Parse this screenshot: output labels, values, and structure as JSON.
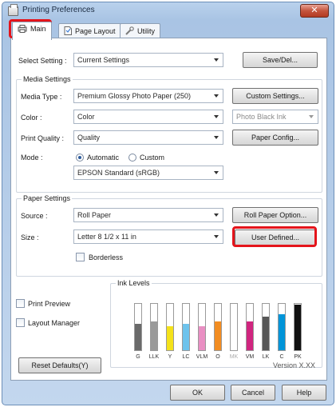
{
  "window": {
    "title": "Printing Preferences",
    "close_label": "✕"
  },
  "tabs": [
    {
      "label": "Main",
      "icon": "printer-icon",
      "active": true
    },
    {
      "label": "Page Layout",
      "icon": "page-layout-icon",
      "active": false
    },
    {
      "label": "Utility",
      "icon": "utility-icon",
      "active": false
    }
  ],
  "select_setting": {
    "label": "Select Setting :",
    "value": "Current Settings",
    "save_del_label": "Save/Del..."
  },
  "media_settings": {
    "group_label": "Media Settings",
    "media_type_label": "Media Type :",
    "media_type_value": "Premium Glossy Photo Paper (250)",
    "custom_settings_label": "Custom Settings...",
    "color_label": "Color :",
    "color_value": "Color",
    "black_ink_value": "Photo Black Ink",
    "print_quality_label": "Print Quality :",
    "print_quality_value": "Quality",
    "paper_config_label": "Paper Config...",
    "mode_label": "Mode :",
    "mode_automatic_label": "Automatic",
    "mode_custom_label": "Custom",
    "mode_selected": "Automatic",
    "color_mode_value": "EPSON Standard (sRGB)"
  },
  "paper_settings": {
    "group_label": "Paper Settings",
    "source_label": "Source :",
    "source_value": "Roll Paper",
    "roll_paper_option_label": "Roll Paper Option...",
    "size_label": "Size :",
    "size_value": "Letter 8 1/2 x 11 in",
    "user_defined_label": "User Defined...",
    "borderless_label": "Borderless"
  },
  "options": {
    "print_preview_label": "Print Preview",
    "layout_manager_label": "Layout Manager"
  },
  "ink_levels": {
    "group_label": "Ink Levels",
    "inks": [
      {
        "label": "G",
        "level": 0.55,
        "color": "#6a6a6a"
      },
      {
        "label": "LLK",
        "level": 0.6,
        "color": "#9a9a9a"
      },
      {
        "label": "Y",
        "level": 0.5,
        "color": "#f4e21a"
      },
      {
        "label": "LC",
        "level": 0.55,
        "color": "#6ec3ec"
      },
      {
        "label": "VLM",
        "level": 0.5,
        "color": "#e98fc3"
      },
      {
        "label": "O",
        "level": 0.6,
        "color": "#f28d22"
      },
      {
        "label": "MK",
        "level": 0.0,
        "color": "#1a1a1a",
        "disabled": true
      },
      {
        "label": "VM",
        "level": 0.6,
        "color": "#d0257f"
      },
      {
        "label": "LK",
        "level": 0.7,
        "color": "#575757"
      },
      {
        "label": "C",
        "level": 0.75,
        "color": "#0094d8"
      },
      {
        "label": "PK",
        "level": 0.95,
        "color": "#111111"
      }
    ]
  },
  "footer": {
    "reset_defaults_label": "Reset Defaults(Y)",
    "version_label": "Version X.XX",
    "ok_label": "OK",
    "cancel_label": "Cancel",
    "help_label": "Help"
  },
  "colors": {
    "highlight": "#e4141b",
    "title_bar": "#b9d1ec"
  }
}
